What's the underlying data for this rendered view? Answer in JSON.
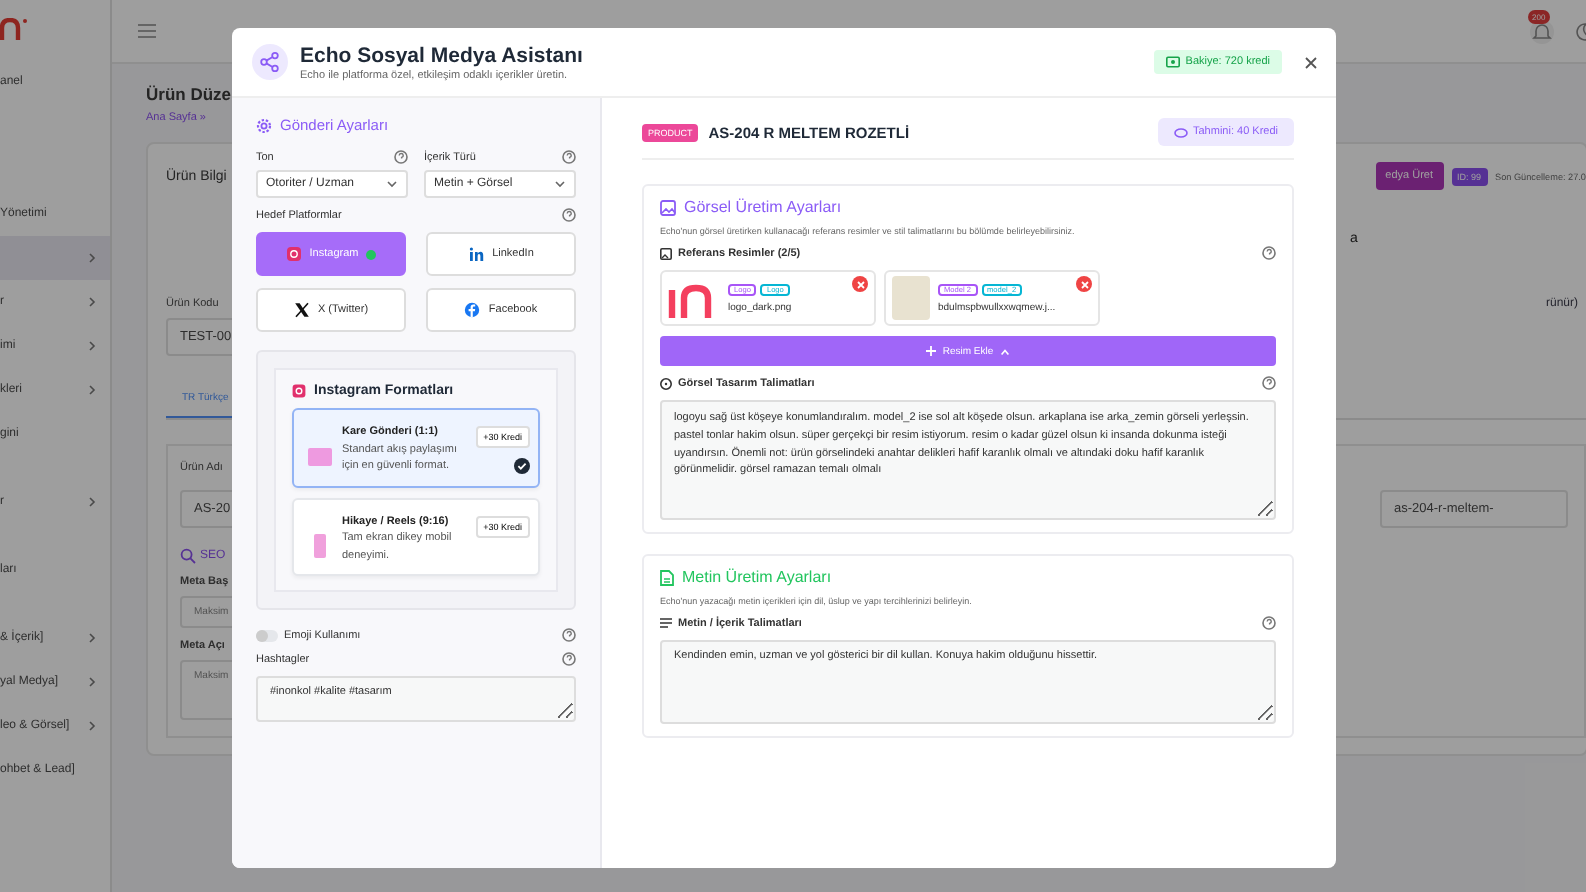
{
  "background": {
    "sidebar": {
      "sections": [
        {
          "items": [
            {
              "label": "anel",
              "selected": false,
              "expandable": false
            }
          ]
        },
        {
          "items": [
            {
              "label": "Yönetimi",
              "selected": false,
              "expandable": false
            },
            {
              "selected": true,
              "expandable": true
            },
            {
              "label": "r",
              "selected": false,
              "expandable": true
            },
            {
              "label": "imi",
              "selected": false,
              "expandable": true
            },
            {
              "label": "kleri",
              "selected": false,
              "expandable": true
            },
            {
              "label": "gini",
              "selected": false,
              "expandable": false
            }
          ]
        },
        {
          "items": [
            {
              "label": "r",
              "selected": false,
              "expandable": true
            }
          ]
        },
        {
          "items": [
            {
              "label": "ları",
              "selected": false,
              "expandable": false
            }
          ]
        },
        {
          "items": [
            {
              "label": "& İçerik]",
              "selected": false,
              "expandable": true
            },
            {
              "label": "yal Medya]",
              "selected": false,
              "expandable": true
            },
            {
              "label": "leo & Görsel]",
              "selected": false,
              "expandable": true
            },
            {
              "label": "ohbet & Lead]",
              "selected": false,
              "expandable": false
            }
          ]
        }
      ]
    },
    "header": {
      "notification_count": "200"
    },
    "page": {
      "title": "Ürün Düze",
      "breadcrumb": "Ana Sayfa »",
      "card_title": "Ürün Bilgi",
      "action_button": "edya Üret",
      "id_badge": "ID: 99",
      "updated": "Son Güncelleme: 27.0",
      "fragment_1": "a",
      "code_label": "Ürün Kodu",
      "code_value": "TEST-00",
      "fragment_2": "rünür)",
      "tabs": [
        {
          "label": "TR Türkçe",
          "selected": true
        }
      ],
      "name_label": "Ürün Adı",
      "name_value": "AS-20",
      "slug_value": "as-204-r-meltem-",
      "seo_title": "SEO",
      "meta_title_label": "Meta Baş",
      "meta_title_placeholder": "Maksim",
      "meta_desc_label": "Meta Açı",
      "meta_desc_placeholder": "Maksim"
    }
  },
  "modal": {
    "title": "Echo Sosyal Medya Asistanı",
    "subtitle": "Echo ile platforma özel, etkileşim odaklı içerikler üretin.",
    "balance": "Bakiye: 720 kredi",
    "settings": {
      "title": "Gönderi Ayarları",
      "selects": [
        {
          "label": "Ton",
          "value": "Otoriter / Uzman"
        },
        {
          "label": "İçerik Türü",
          "value": "Metin + Görsel"
        }
      ],
      "platforms_label": "Hedef Platformlar",
      "platforms": [
        {
          "kind": "instagram",
          "label": "Instagram",
          "selected": true
        },
        {
          "kind": "linkedin",
          "label": "LinkedIn",
          "selected": false
        },
        {
          "kind": "x",
          "label": "X (Twitter)",
          "selected": false
        },
        {
          "kind": "facebook",
          "label": "Facebook",
          "selected": false
        }
      ],
      "formats_title": "Instagram Formatları",
      "formats": [
        {
          "kind": "square",
          "title": "Kare Gönderi (1:1)",
          "description": "Standart akış paylaşımı için en güvenli format.",
          "cost": "+30 Kredi",
          "selected": true
        },
        {
          "kind": "story",
          "title": "Hikaye / Reels (9:16)",
          "description": "Tam ekran dikey mobil deneyimi.",
          "cost": "+30 Kredi",
          "selected": false
        }
      ],
      "emoji": {
        "label": "Emoji Kullanımı",
        "on": false
      },
      "hashtags": {
        "label": "Hashtagler",
        "value": "#inonkol #kalite #tasarım"
      }
    },
    "product": {
      "tag": "PRODUCT",
      "name": "AS-204 R MELTEM ROZETLİ",
      "estimate": "Tahmini: 40 Kredi"
    },
    "visual": {
      "title": "Görsel Üretim Ayarları",
      "description": "Echo'nun görsel üretirken kullanacağı referans resimler ve stil talimatlarını bu bölümde belirleyebilirsiniz.",
      "references_label": "Referans Resimler (2/5)",
      "images": [
        {
          "kind": "logo",
          "tags": [
            {
              "label": "Logo",
              "color": "#a855f7"
            },
            {
              "label": "Logo",
              "color": "#06b6d4"
            }
          ],
          "filename": "logo_dark.png"
        },
        {
          "kind": "photo",
          "tags": [
            {
              "label": "Model 2",
              "color": "#a855f7"
            },
            {
              "label": "model_2",
              "color": "#06b6d4"
            }
          ],
          "filename": "bdulmspbwullxxwqmew.j..."
        }
      ],
      "add_button": "Resim Ekle",
      "instructions_label": "Görsel Tasarım Talimatları",
      "instructions": "logoyu sağ üst köşeye konumlandıralım. model_2 ise sol alt köşede olsun. arkaplana ise arka_zemin görseli yerleşsin. pastel tonlar hakim olsun. süper gerçekçi bir resim istiyorum. resim o kadar güzel olsun ki insanda dokunma isteği uyandırsın. Önemli not: ürün görselindeki anahtar delikleri hafif karanlık olmalı ve altındaki doku hafif karanlık görünmelidir. görsel ramazan temalı olmalı"
    },
    "text": {
      "title": "Metin Üretim Ayarları",
      "description": "Echo'nun yazacağı metin içerikleri için dil, üslup ve yapı tercihlerinizi belirleyin.",
      "instructions_label": "Metin / İçerik Talimatları",
      "instructions": "Kendinden emin, uzman ve yol gösterici bir dil kullan. Konuya hakim olduğunu hissettir."
    }
  }
}
